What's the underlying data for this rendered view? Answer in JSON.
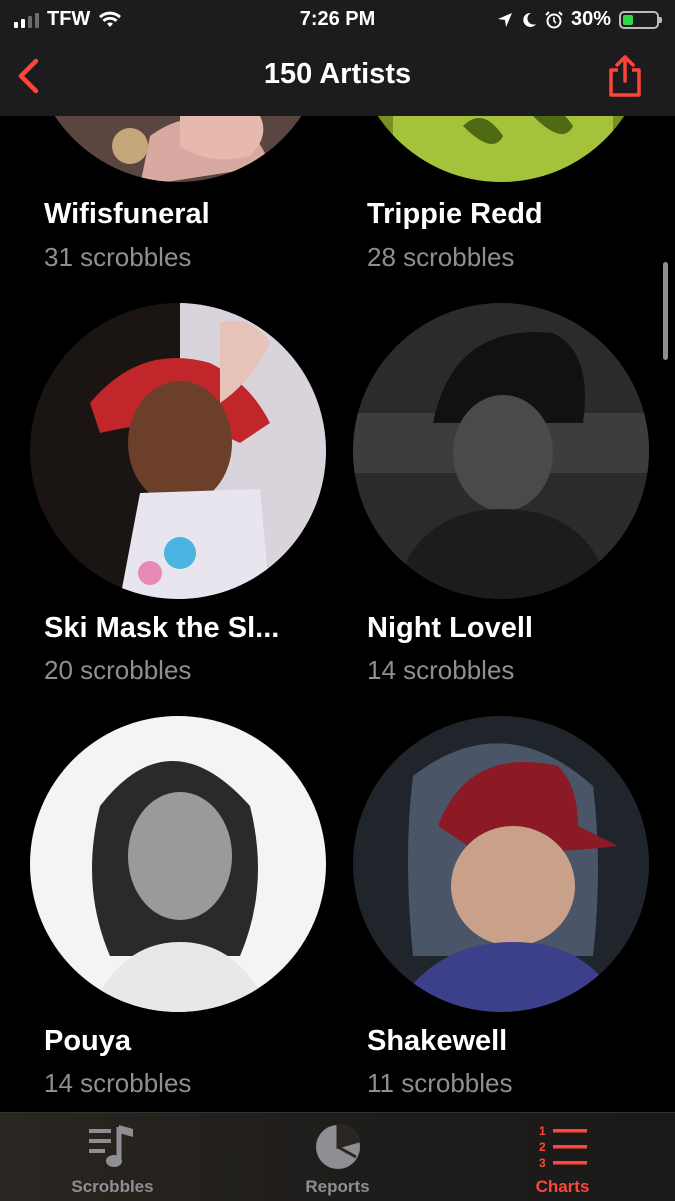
{
  "status_bar": {
    "carrier": "TFW",
    "time": "7:26 PM",
    "battery": "30%",
    "battery_level": 0.3,
    "icons": [
      "signal-icon",
      "wifi-icon",
      "location-icon",
      "moon-icon",
      "alarm-icon",
      "battery-charging-icon"
    ]
  },
  "nav": {
    "title": "150 Artists",
    "back_icon": "chevron-left-icon",
    "share_icon": "share-icon"
  },
  "artists": [
    {
      "name": "Wifisfuneral",
      "scrobbles": "31 scrobbles"
    },
    {
      "name": "Trippie Redd",
      "scrobbles": "28 scrobbles"
    },
    {
      "name": "Ski Mask the Sl...",
      "scrobbles": "20 scrobbles"
    },
    {
      "name": "Night Lovell",
      "scrobbles": "14 scrobbles"
    },
    {
      "name": "Pouya",
      "scrobbles": "14 scrobbles"
    },
    {
      "name": "Shakewell",
      "scrobbles": "11 scrobbles"
    }
  ],
  "tabs": [
    {
      "label": "Scrobbles",
      "icon": "music-note-list-icon",
      "active": false
    },
    {
      "label": "Reports",
      "icon": "pie-chart-icon",
      "active": false
    },
    {
      "label": "Charts",
      "icon": "numbered-list-icon",
      "active": true
    }
  ],
  "colors": {
    "accent": "#ff453a",
    "background": "#000000",
    "secondary_text": "#8e8e93"
  }
}
